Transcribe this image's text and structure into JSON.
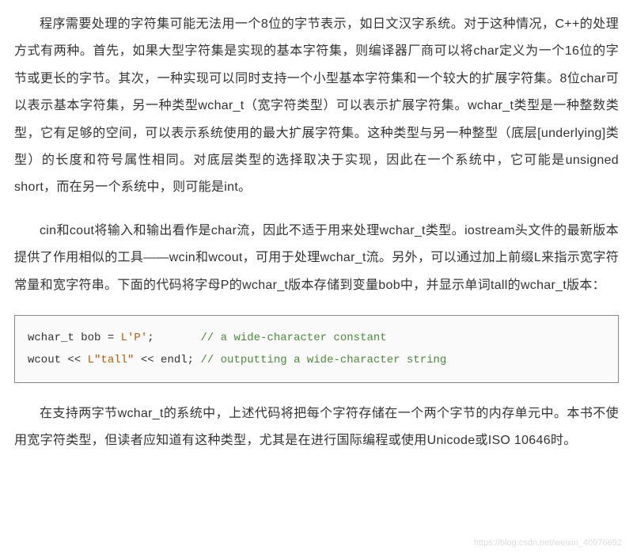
{
  "paragraphs": {
    "p1": "程序需要处理的字符集可能无法用一个8位的字节表示，如日文汉字系统。对于这种情况，C++的处理方式有两种。首先，如果大型字符集是实现的基本字符集，则编译器厂商可以将char定义为一个16位的字节或更长的字节。其次，一种实现可以同时支持一个小型基本字符集和一个较大的扩展字符集。8位char可以表示基本字符集，另一种类型wchar_t（宽字符类型）可以表示扩展字符集。wchar_t类型是一种整数类型，它有足够的空间，可以表示系统使用的最大扩展字符集。这种类型与另一种整型（底层[underlying]类型）的长度和符号属性相同。对底层类型的选择取决于实现，因此在一个系统中，它可能是unsigned short，而在另一个系统中，则可能是int。",
    "p2": "cin和cout将输入和输出看作是char流，因此不适于用来处理wchar_t类型。iostream头文件的最新版本提供了作用相似的工具——wcin和wcout，可用于处理wchar_t流。另外，可以通过加上前缀L来指示宽字符常量和宽字符串。下面的代码将字母P的wchar_t版本存储到变量bob中，并显示单词tall的wchar_t版本：",
    "p3": "在支持两字节wchar_t的系统中，上述代码将把每个字符存储在一个两个字节的内存单元中。本书不使用宽字符类型，但读者应知道有这种类型，尤其是在进行国际编程或使用Unicode或ISO 10646时。"
  },
  "code": {
    "line1": {
      "prefix": "wchar_t bob = ",
      "literal": "L'P'",
      "suffix": ";       ",
      "comment": "// a wide-character constant"
    },
    "line2": {
      "prefix": "wcout << ",
      "literal": "L\"tall\"",
      "suffix": " << endl; ",
      "comment": "// outputting a wide-character string"
    }
  },
  "watermark": "https://blog.csdn.net/weixin_40976692"
}
